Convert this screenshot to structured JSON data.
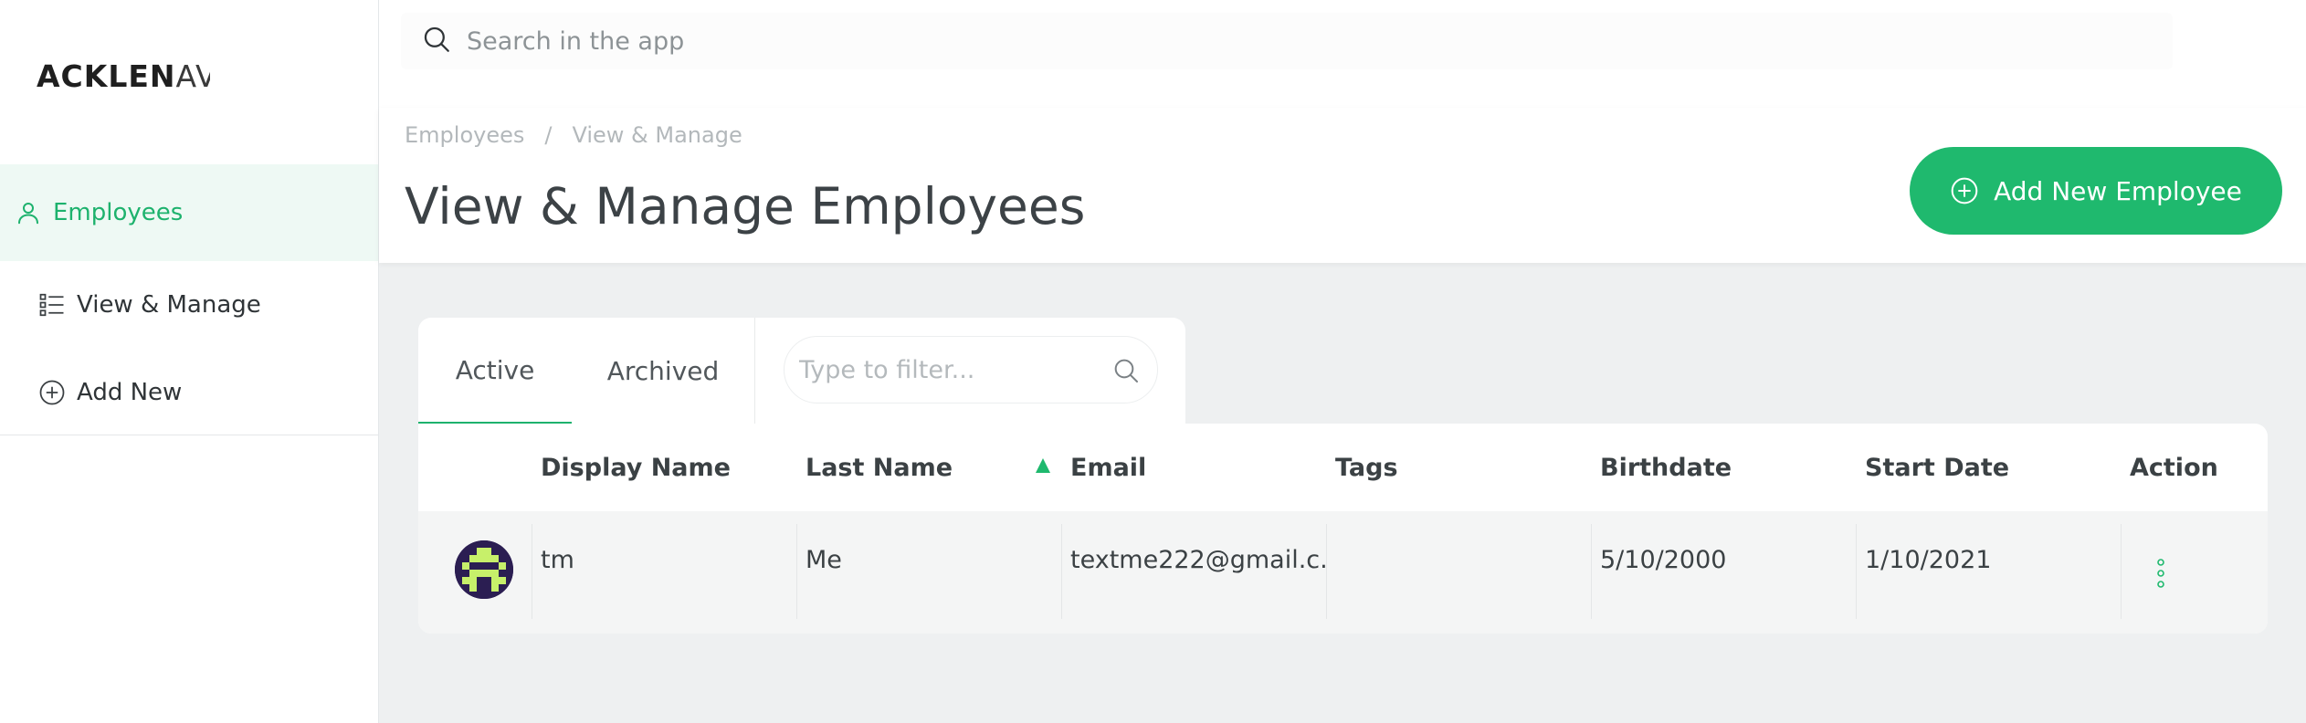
{
  "brand": {
    "logo_main": "ACKLEN",
    "logo_tail": "AV"
  },
  "sidebar": {
    "section": {
      "label": "Employees"
    },
    "items": [
      {
        "label": "View & Manage"
      },
      {
        "label": "Add New"
      }
    ]
  },
  "topbar": {
    "search_placeholder": "Search in the app"
  },
  "breadcrumb": {
    "root": "Employees",
    "separator": "/",
    "current": "View & Manage"
  },
  "header": {
    "title": "View & Manage Employees",
    "add_button": "Add New Employee"
  },
  "tabs": [
    {
      "label": "Active",
      "active": true
    },
    {
      "label": "Archived",
      "active": false
    }
  ],
  "filter": {
    "placeholder": "Type to filter..."
  },
  "table": {
    "columns": [
      "Display Name",
      "Last Name",
      "Email",
      "Tags",
      "Birthdate",
      "Start Date",
      "Action"
    ],
    "sorted_column": "Last Name",
    "rows": [
      {
        "display_name": "tm",
        "last_name": "Me",
        "email": "textme222@gmail.c...",
        "tags": "",
        "birthdate": "5/10/2000",
        "start_date": "1/10/2021"
      }
    ]
  },
  "colors": {
    "accent": "#1fb96e",
    "sidebar_active_bg": "#eef9f4",
    "avatar_bg": "#2b1e52",
    "avatar_fg": "#c7f06a"
  },
  "icons": [
    "search-icon",
    "user-icon",
    "list-icon",
    "plus-circle-icon",
    "sort-asc-icon",
    "kebab-icon"
  ]
}
